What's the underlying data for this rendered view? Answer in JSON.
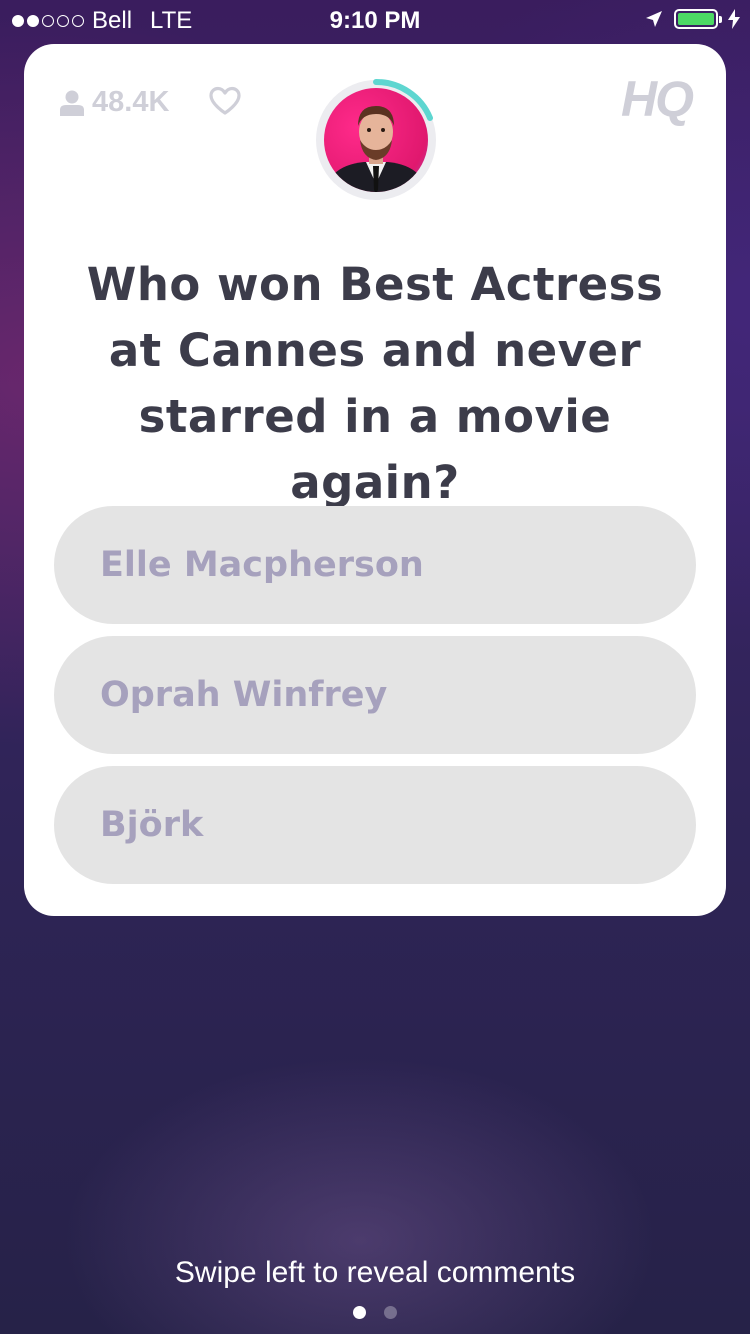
{
  "status_bar": {
    "carrier": "Bell",
    "network": "LTE",
    "time": "9:10 PM",
    "signal_bars_filled": 2,
    "signal_bars_total": 5,
    "battery_color": "#4cd964"
  },
  "card": {
    "viewer_count": "48.4K",
    "logo": "HQ",
    "question": "Who won Best Actress at Cannes and never starred in a movie again?",
    "answers": [
      {
        "label": "Elle Macpherson"
      },
      {
        "label": "Oprah Winfrey"
      },
      {
        "label": "Björk"
      }
    ],
    "timer_accent": "#5ed6d0"
  },
  "footer": {
    "hint": "Swipe left to reveal comments",
    "page_index": 0,
    "page_count": 2
  }
}
